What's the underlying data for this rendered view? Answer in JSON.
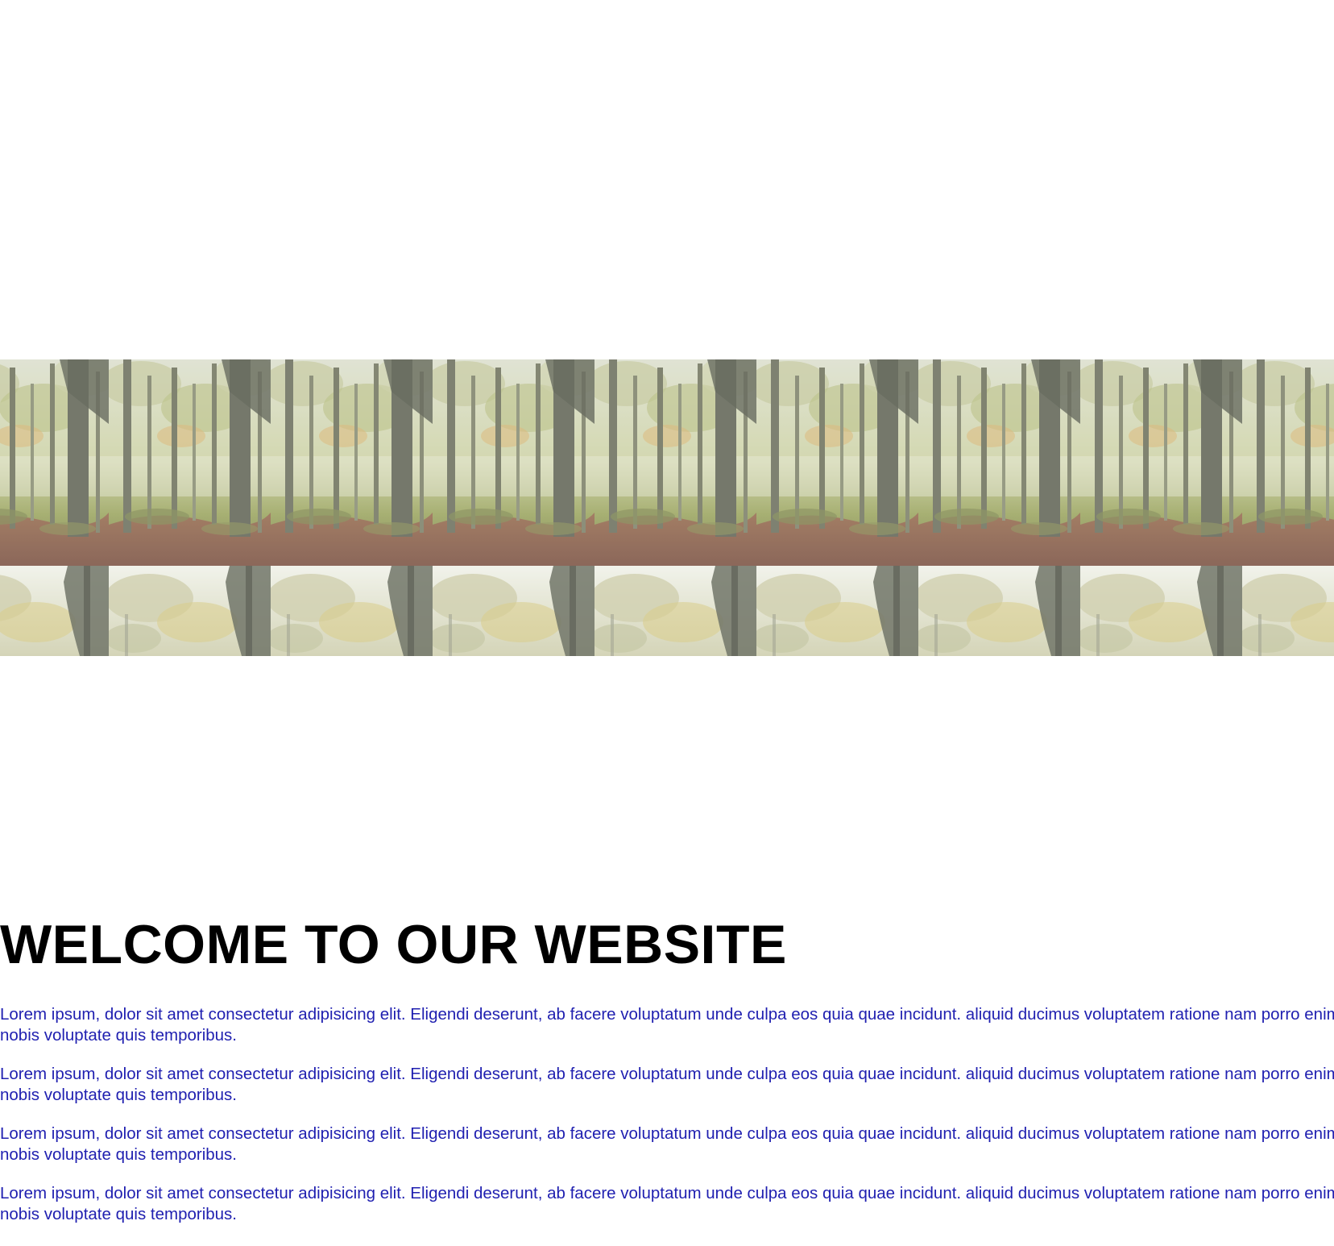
{
  "banner": {
    "image_name": "misty-forest-tile-image",
    "palette": {
      "sky": "#e9ebe2",
      "mist": "#cfd2bd",
      "foliage": "#8e9a4a",
      "trunk_dark": "#4d5240",
      "ground": "#7a4a35",
      "leaf_gold": "#c9b04a"
    }
  },
  "heading": {
    "text": "WELCOME TO OUR WEBSITE"
  },
  "paragraphs": [
    "Lorem ipsum, dolor sit amet consectetur adipisicing elit. Eligendi deserunt, ab facere voluptatum unde culpa eos quia quae incidunt. aliquid ducimus voluptatem ratione nam porro enim nobis voluptate quis temporibus.",
    "Lorem ipsum, dolor sit amet consectetur adipisicing elit. Eligendi deserunt, ab facere voluptatum unde culpa eos quia quae incidunt. aliquid ducimus voluptatem ratione nam porro enim nobis voluptate quis temporibus.",
    "Lorem ipsum, dolor sit amet consectetur adipisicing elit. Eligendi deserunt, ab facere voluptatum unde culpa eos quia quae incidunt. aliquid ducimus voluptatem ratione nam porro enim nobis voluptate quis temporibus.",
    "Lorem ipsum, dolor sit amet consectetur adipisicing elit. Eligendi deserunt, ab facere voluptatum unde culpa eos quia quae incidunt. aliquid ducimus voluptatem ratione nam porro enim nobis voluptate quis temporibus."
  ],
  "colors": {
    "heading": "#000000",
    "paragraph": "#1f1fb0",
    "background": "#ffffff"
  }
}
